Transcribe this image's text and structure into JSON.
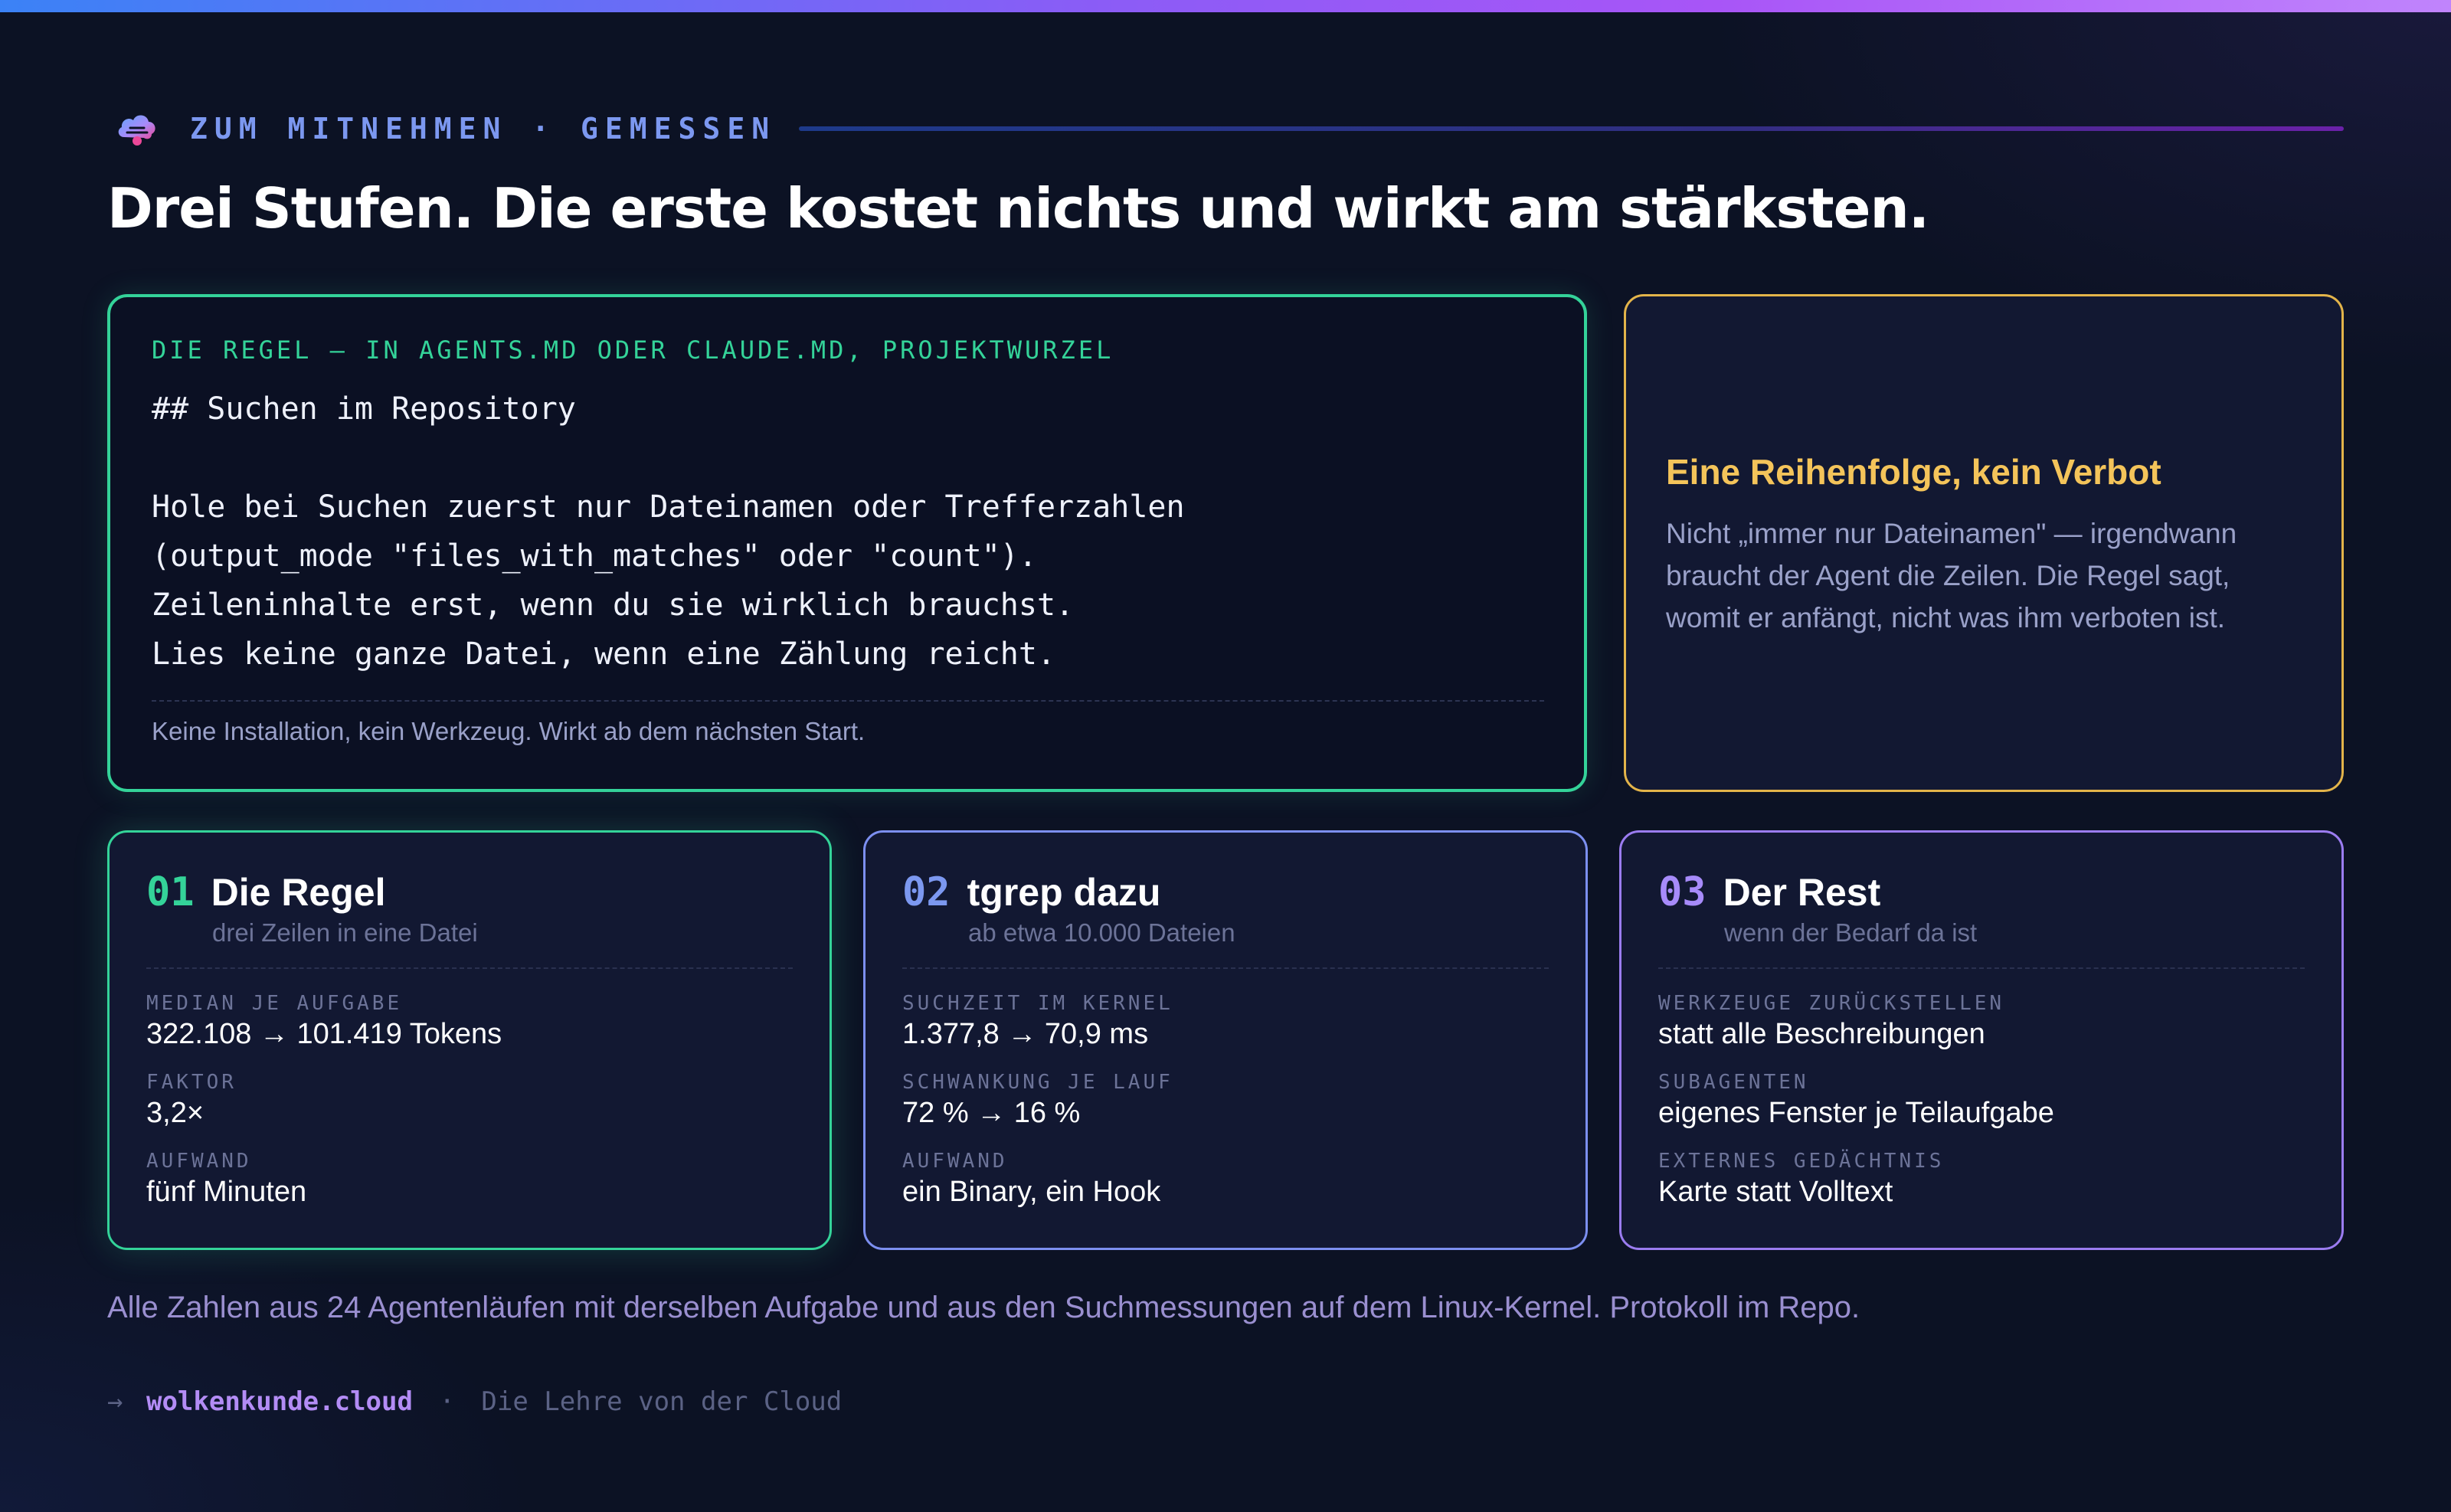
{
  "header": {
    "kicker": "ZUM MITNEHMEN · GEMESSEN",
    "title": "Drei Stufen. Die erste kostet nichts und wirkt am stärksten."
  },
  "rule_card": {
    "label": "DIE REGEL — IN AGENTS.MD ODER CLAUDE.MD, PROJEKTWURZEL",
    "code_lines": [
      "## Suchen im Repository",
      "",
      "Hole bei Suchen zuerst nur Dateinamen oder Trefferzahlen",
      "(output_mode \"files_with_matches\" oder \"count\").",
      "Zeileninhalte erst, wenn du sie wirklich brauchst.",
      "Lies keine ganze Datei, wenn eine Zählung reicht."
    ],
    "footer": "Keine Installation, kein Werkzeug. Wirkt ab dem nächsten Start."
  },
  "note_card": {
    "title": "Eine Reihenfolge, kein Verbot",
    "text": "Nicht „immer nur Dateinamen\" — irgendwann braucht der Agent die Zeilen. Die Regel sagt, womit er anfängt, nicht was ihm verboten ist."
  },
  "steps": [
    {
      "num": "01",
      "title": "Die Regel",
      "subtitle": "drei Zeilen in eine Datei",
      "metrics": [
        {
          "label": "MEDIAN JE AUFGABE",
          "value": "322.108 → 101.419 Tokens"
        },
        {
          "label": "FAKTOR",
          "value": "3,2×"
        },
        {
          "label": "AUFWAND",
          "value": "fünf Minuten"
        }
      ]
    },
    {
      "num": "02",
      "title": "tgrep dazu",
      "subtitle": "ab etwa 10.000 Dateien",
      "metrics": [
        {
          "label": "SUCHZEIT IM KERNEL",
          "value": "1.377,8 → 70,9 ms"
        },
        {
          "label": "SCHWANKUNG JE LAUF",
          "value": "72 % → 16 %"
        },
        {
          "label": "AUFWAND",
          "value": "ein Binary, ein Hook"
        }
      ]
    },
    {
      "num": "03",
      "title": "Der Rest",
      "subtitle": "wenn der Bedarf da ist",
      "metrics": [
        {
          "label": "WERKZEUGE ZURÜCKSTELLEN",
          "value": "statt alle Beschreibungen"
        },
        {
          "label": "SUBAGENTEN",
          "value": "eigenes Fenster je Teilaufgabe"
        },
        {
          "label": "EXTERNES GEDÄCHTNIS",
          "value": "Karte statt Volltext"
        }
      ]
    }
  ],
  "footnote": "Alle Zahlen aus 24 Agentenläufen mit derselben Aufgabe und aus den Suchmessungen auf dem Linux-Kernel. Protokoll im Repo.",
  "footer": {
    "arrow": "→",
    "site": "wolkenkunde.cloud",
    "separator": "·",
    "tagline": "Die Lehre von der Cloud"
  },
  "icons": {
    "logo": "cloud-logo-icon"
  },
  "colors": {
    "accent_green": "#34d399",
    "accent_blue": "#7c98f0",
    "accent_purple": "#a78bfa",
    "accent_yellow": "#f4c45a",
    "background": "#0c1224"
  }
}
